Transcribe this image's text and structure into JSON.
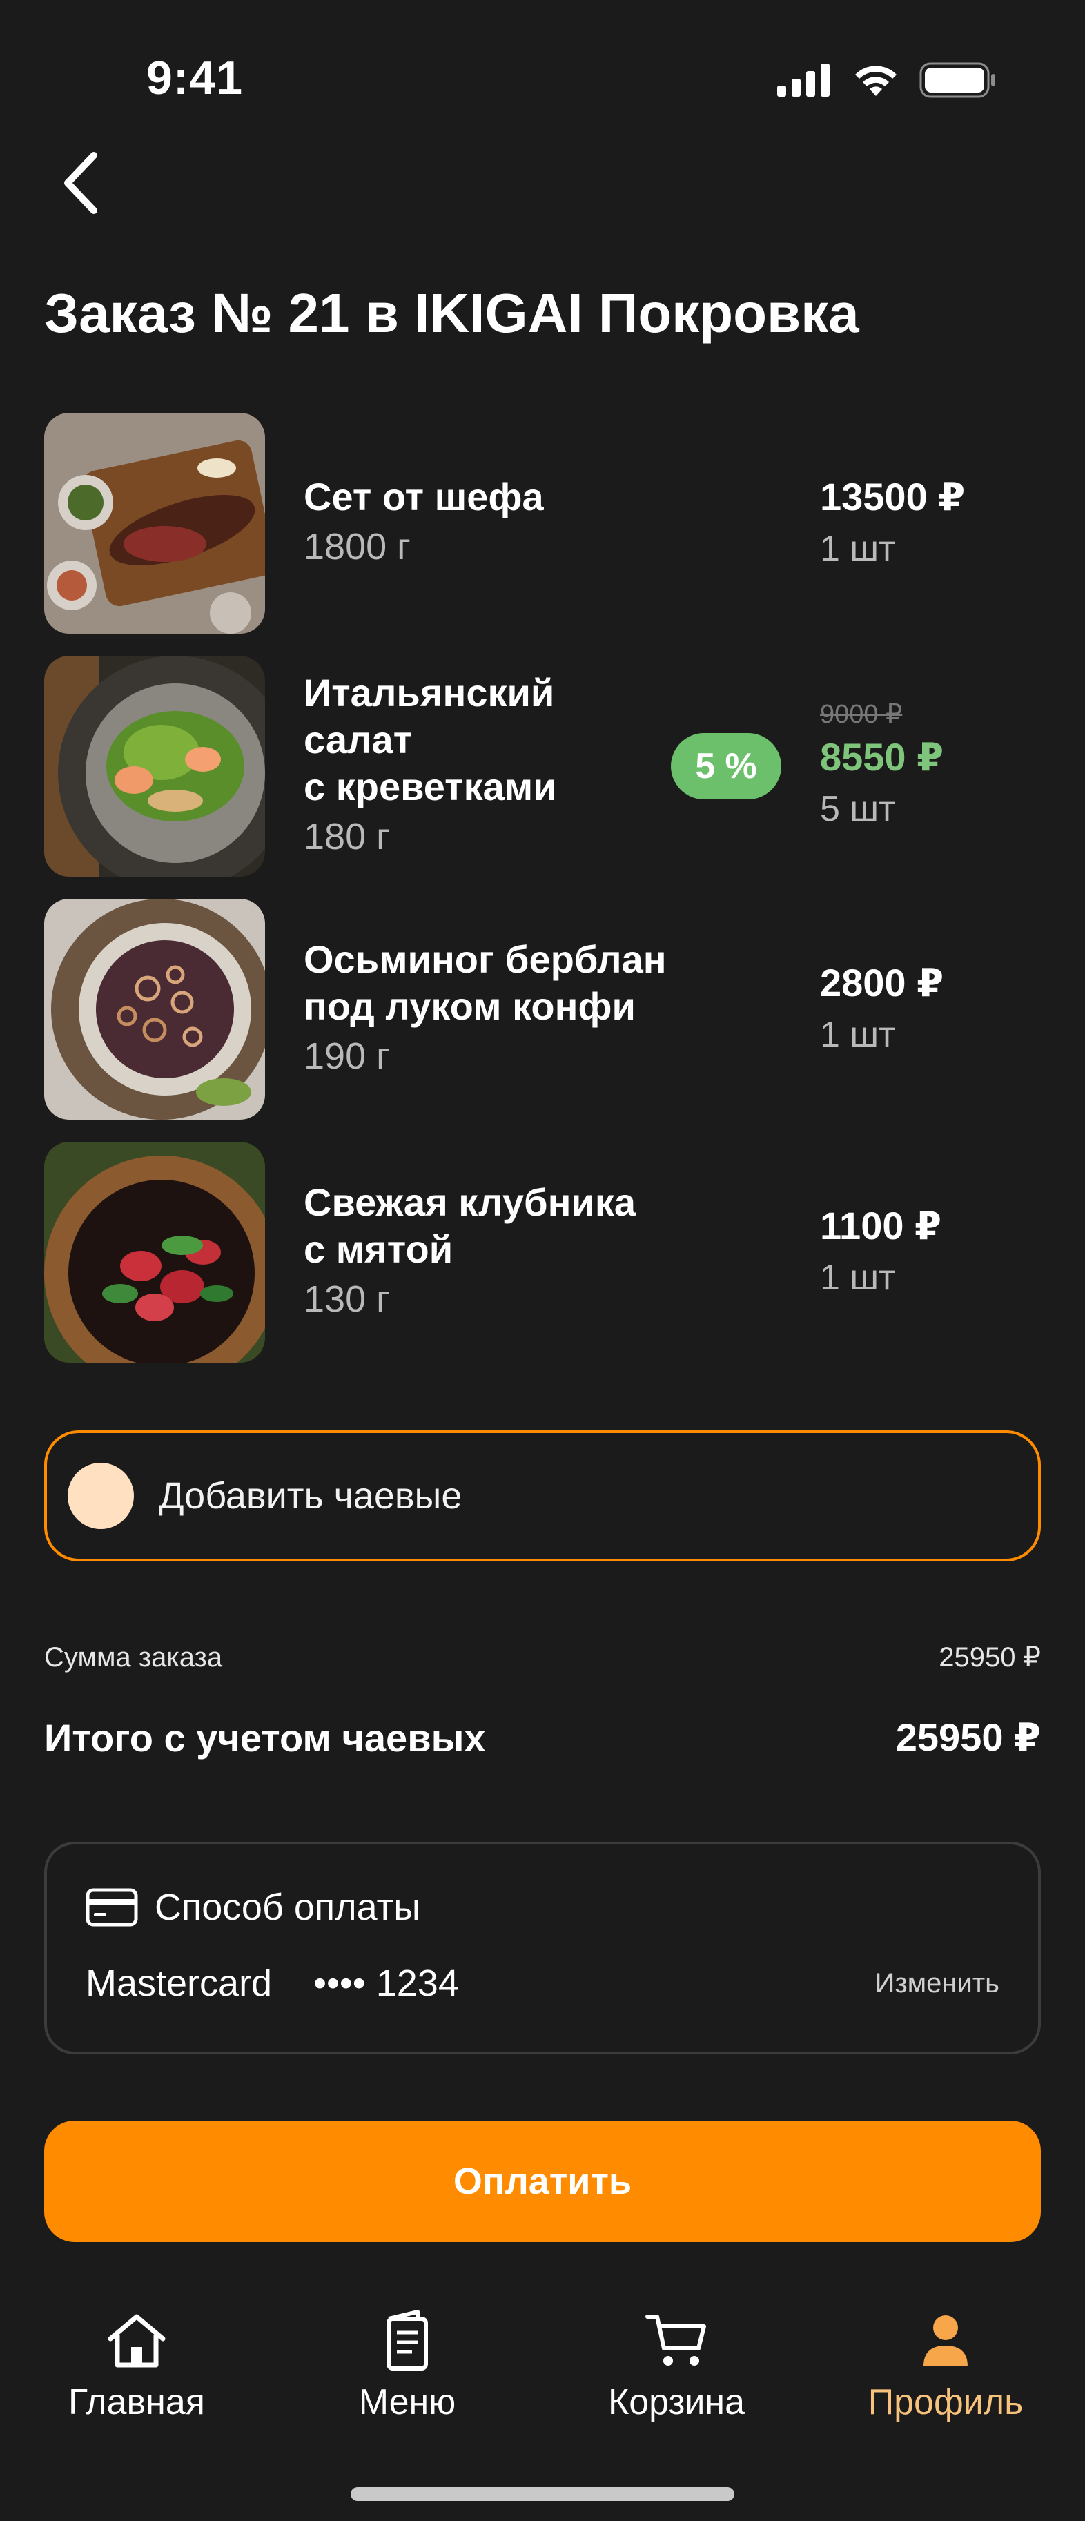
{
  "status": {
    "time": "9:41"
  },
  "page_title": "Заказ № 21 в IKIGAI Покровка",
  "items": [
    {
      "name": "Сет от шефа",
      "weight": "1800 г",
      "price": "13500 ₽",
      "qty": "1 шт"
    },
    {
      "name": "Итальянский\nсалат\nс креветками",
      "weight": "180 г",
      "old_price": "9000 ₽",
      "price": "8550 ₽",
      "qty": "5 шт",
      "discount": "5 %"
    },
    {
      "name": "Осьминог берблан\nпод луком конфи",
      "weight": "190 г",
      "price": "2800 ₽",
      "qty": "1 шт"
    },
    {
      "name": "Свежая клубника\nс мятой",
      "weight": "130 г",
      "price": "1100 ₽",
      "qty": "1 шт"
    }
  ],
  "tips": {
    "label": "Добавить чаевые"
  },
  "summary": {
    "order_sum_label": "Сумма заказа",
    "order_sum_value": "25950 ₽",
    "total_label": "Итого с учетом чаевых",
    "total_value": "25950 ₽"
  },
  "payment": {
    "title": "Способ оплаты",
    "card_brand": "Mastercard",
    "card_number": "•••• 1234",
    "change_label": "Изменить"
  },
  "pay_button": "Оплатить",
  "tabs": [
    {
      "label": "Главная",
      "icon": "home-icon"
    },
    {
      "label": "Меню",
      "icon": "menu-book-icon"
    },
    {
      "label": "Корзина",
      "icon": "cart-icon"
    },
    {
      "label": "Профиль",
      "icon": "profile-icon",
      "active": true
    }
  ],
  "colors": {
    "background": "#1b1b1b",
    "accent": "#ff8c00",
    "discount": "#6cc06b",
    "active_tab": "#f7c27c"
  }
}
